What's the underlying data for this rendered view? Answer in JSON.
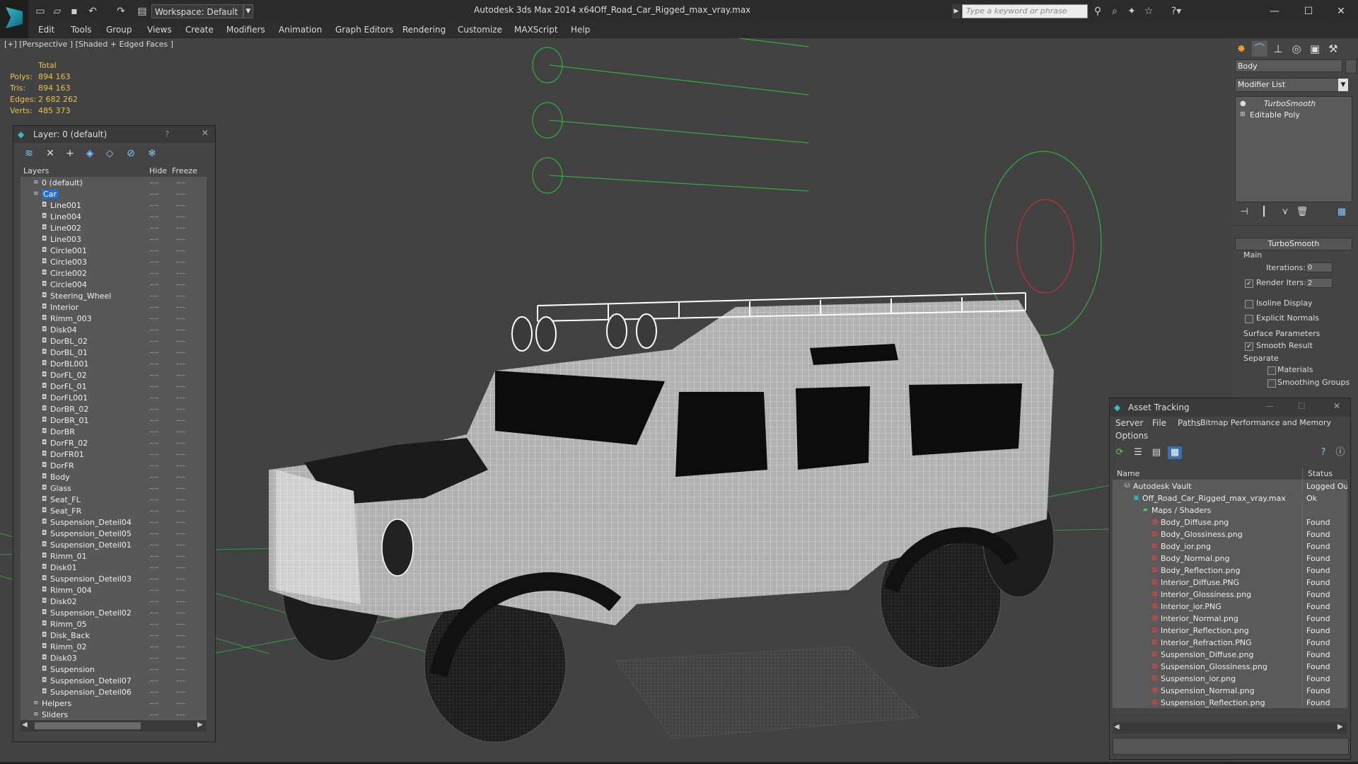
{
  "titlebar": {
    "app_title": "Autodesk 3ds Max 2014 x64",
    "file_title": "Off_Road_Car_Rigged_max_vray.max",
    "workspace": "Workspace: Default",
    "search_placeholder": "Type a keyword or phrase"
  },
  "menus": [
    "Edit",
    "Tools",
    "Group",
    "Views",
    "Create",
    "Modifiers",
    "Animation",
    "Graph Editors",
    "Rendering",
    "Customize",
    "MAXScript",
    "Help"
  ],
  "viewport": {
    "label": "[+] [Perspective ] [Shaded + Edged Faces ]",
    "stats_header": "Total",
    "stats": [
      {
        "label": "Polys:",
        "value": "894 163"
      },
      {
        "label": "Tris:",
        "value": "894 163"
      },
      {
        "label": "Edges:",
        "value": "2 682 262"
      },
      {
        "label": "Verts:",
        "value": "485 373"
      }
    ]
  },
  "layer_dialog": {
    "title": "Layer: 0 (default)",
    "help": "?",
    "columns": {
      "layers": "Layers",
      "hide": "Hide",
      "freeze": "Freeze"
    },
    "rows": [
      {
        "name": "0 (default)",
        "level": 0
      },
      {
        "name": "Car",
        "level": 0,
        "selected": true
      },
      {
        "name": "Line001",
        "level": 1
      },
      {
        "name": "Line004",
        "level": 1
      },
      {
        "name": "Line002",
        "level": 1
      },
      {
        "name": "Line003",
        "level": 1
      },
      {
        "name": "Circle001",
        "level": 1
      },
      {
        "name": "Circle003",
        "level": 1
      },
      {
        "name": "Circle002",
        "level": 1
      },
      {
        "name": "Circle004",
        "level": 1
      },
      {
        "name": "Steering_Wheel",
        "level": 1
      },
      {
        "name": "Interior",
        "level": 1
      },
      {
        "name": "Rimm_003",
        "level": 1
      },
      {
        "name": "Disk04",
        "level": 1
      },
      {
        "name": "DorBL_02",
        "level": 1
      },
      {
        "name": "DorBL_01",
        "level": 1
      },
      {
        "name": "DorBL001",
        "level": 1
      },
      {
        "name": "DorFL_02",
        "level": 1
      },
      {
        "name": "DorFL_01",
        "level": 1
      },
      {
        "name": "DorFL001",
        "level": 1
      },
      {
        "name": "DorBR_02",
        "level": 1
      },
      {
        "name": "DorBR_01",
        "level": 1
      },
      {
        "name": "DorBR",
        "level": 1
      },
      {
        "name": "DorFR_02",
        "level": 1
      },
      {
        "name": "DorFR01",
        "level": 1
      },
      {
        "name": "DorFR",
        "level": 1
      },
      {
        "name": "Body",
        "level": 1
      },
      {
        "name": "Glass",
        "level": 1
      },
      {
        "name": "Seat_FL",
        "level": 1
      },
      {
        "name": "Seat_FR",
        "level": 1
      },
      {
        "name": "Suspension_Deteil04",
        "level": 1
      },
      {
        "name": "Suspension_Deteil05",
        "level": 1
      },
      {
        "name": "Suspension_Deteil01",
        "level": 1
      },
      {
        "name": "Rimm_01",
        "level": 1
      },
      {
        "name": "Disk01",
        "level": 1
      },
      {
        "name": "Suspension_Deteil03",
        "level": 1
      },
      {
        "name": "Rimm_004",
        "level": 1
      },
      {
        "name": "Disk02",
        "level": 1
      },
      {
        "name": "Suspension_Deteil02",
        "level": 1
      },
      {
        "name": "Rimm_05",
        "level": 1
      },
      {
        "name": "Disk_Back",
        "level": 1
      },
      {
        "name": "Rimm_02",
        "level": 1
      },
      {
        "name": "Disk03",
        "level": 1
      },
      {
        "name": "Suspension",
        "level": 1
      },
      {
        "name": "Suspension_Deteil07",
        "level": 1
      },
      {
        "name": "Suspension_Deteil06",
        "level": 1
      },
      {
        "name": "Helpers",
        "level": 0
      },
      {
        "name": "Sliders",
        "level": 0
      }
    ]
  },
  "command_panel": {
    "object_name": "Body",
    "modifier_list": "Modifier List",
    "stack": [
      "TurboSmooth",
      "Editable Poly"
    ],
    "rollout": "TurboSmooth",
    "main_label": "Main",
    "iterations_label": "Iterations:",
    "iterations_value": "0",
    "render_iters_label": "Render Iters:",
    "render_iters_value": "2",
    "isoline": "Isoline Display",
    "explicit_normals": "Explicit Normals",
    "surface_params": "Surface Parameters",
    "smooth_result": "Smooth Result",
    "separate": "Separate",
    "materials": "Materials",
    "smoothing_groups": "Smoothing Groups"
  },
  "asset_tracking": {
    "title": "Asset Tracking",
    "menus": [
      "Server",
      "File",
      "Paths",
      "Bitmap Performance and Memory",
      "Options"
    ],
    "columns": {
      "name": "Name",
      "status": "Status"
    },
    "rows": [
      {
        "name": "Autodesk Vault",
        "status": "Logged Ou",
        "indent": 1,
        "icon": "vault"
      },
      {
        "name": "Off_Road_Car_Rigged_max_vray.max",
        "status": "Ok",
        "indent": 2,
        "icon": "max"
      },
      {
        "name": "Maps / Shaders",
        "status": "",
        "indent": 3,
        "icon": "folder"
      },
      {
        "name": "Body_Diffuse.png",
        "status": "Found",
        "indent": 4,
        "icon": "img"
      },
      {
        "name": "Body_Glossiness.png",
        "status": "Found",
        "indent": 4,
        "icon": "img"
      },
      {
        "name": "Body_ior.png",
        "status": "Found",
        "indent": 4,
        "icon": "img"
      },
      {
        "name": "Body_Normal.png",
        "status": "Found",
        "indent": 4,
        "icon": "img"
      },
      {
        "name": "Body_Reflection.png",
        "status": "Found",
        "indent": 4,
        "icon": "img"
      },
      {
        "name": "Interior_Diffuse.PNG",
        "status": "Found",
        "indent": 4,
        "icon": "img"
      },
      {
        "name": "Interior_Glossiness.png",
        "status": "Found",
        "indent": 4,
        "icon": "img"
      },
      {
        "name": "Interior_ior.PNG",
        "status": "Found",
        "indent": 4,
        "icon": "img"
      },
      {
        "name": "Interior_Normal.png",
        "status": "Found",
        "indent": 4,
        "icon": "img"
      },
      {
        "name": "Interior_Reflection.png",
        "status": "Found",
        "indent": 4,
        "icon": "img"
      },
      {
        "name": "Interior_Refraction.PNG",
        "status": "Found",
        "indent": 4,
        "icon": "img"
      },
      {
        "name": "Suspension_Diffuse.png",
        "status": "Found",
        "indent": 4,
        "icon": "img"
      },
      {
        "name": "Suspension_Glossiness.png",
        "status": "Found",
        "indent": 4,
        "icon": "img"
      },
      {
        "name": "Suspension_ior.png",
        "status": "Found",
        "indent": 4,
        "icon": "img"
      },
      {
        "name": "Suspension_Normal.png",
        "status": "Found",
        "indent": 4,
        "icon": "img"
      },
      {
        "name": "Suspension_Reflection.png",
        "status": "Found",
        "indent": 4,
        "icon": "img"
      }
    ]
  },
  "colors": {
    "stats": "#e8c24a",
    "selection": "#1f6fd6",
    "helper_green": "#2fae3f",
    "helper_red": "#c43131",
    "wire": "#ffffff"
  }
}
